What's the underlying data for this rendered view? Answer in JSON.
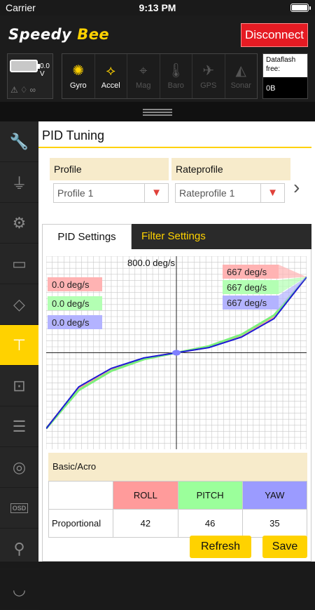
{
  "status_bar": {
    "carrier": "Carrier",
    "time": "9:13 PM"
  },
  "header": {
    "logo_main": "Speedy",
    "logo_accent": "Bee",
    "disconnect_label": "Disconnect",
    "battery_voltage": "0.0 V",
    "sensors": [
      {
        "name": "gyro",
        "label": "Gyro",
        "icon": "gyro-icon",
        "active": true
      },
      {
        "name": "accel",
        "label": "Accel",
        "icon": "accel-icon",
        "active": true
      },
      {
        "name": "mag",
        "label": "Mag",
        "icon": "mag-icon",
        "active": false
      },
      {
        "name": "baro",
        "label": "Baro",
        "icon": "baro-icon",
        "active": false
      },
      {
        "name": "gps",
        "label": "GPS",
        "icon": "gps-icon",
        "active": false
      },
      {
        "name": "sonar",
        "label": "Sonar",
        "icon": "sonar-icon",
        "active": false
      }
    ],
    "dataflash_label": "Dataflash free:",
    "dataflash_value": "0B"
  },
  "sidebar": {
    "items": [
      {
        "icon": "wrench-icon",
        "active": false
      },
      {
        "icon": "plug-icon",
        "active": false
      },
      {
        "icon": "gear-icon",
        "active": false
      },
      {
        "icon": "battery-icon",
        "active": false
      },
      {
        "icon": "parachute-icon",
        "active": false
      },
      {
        "icon": "hierarchy-icon",
        "active": true
      },
      {
        "icon": "receiver-icon",
        "active": false
      },
      {
        "icon": "modes-icon",
        "active": false
      },
      {
        "icon": "motor-icon",
        "active": false
      },
      {
        "icon": "osd-icon",
        "active": false,
        "text": "OSD"
      },
      {
        "icon": "led-icon",
        "active": false
      },
      {
        "icon": "blackbox-icon",
        "active": false
      }
    ]
  },
  "page": {
    "title": "PID Tuning",
    "profile_label": "Profile",
    "profile_value": "Profile 1",
    "rateprofile_label": "Rateprofile",
    "rateprofile_value": "Rateprofile 1",
    "tabs": {
      "pid": "PID Settings",
      "filter": "Filter Settings"
    },
    "basic_label": "Basic/Acro",
    "table": {
      "columns": [
        "ROLL",
        "PITCH",
        "YAW"
      ],
      "rows": [
        {
          "name": "Proportional",
          "values": [
            "42",
            "46",
            "35"
          ]
        }
      ]
    },
    "refresh_label": "Refresh",
    "save_label": "Save"
  },
  "chart_data": {
    "type": "line",
    "title": "800.0 deg/s",
    "xlim": [
      -1,
      1
    ],
    "ylim": [
      -800,
      800
    ],
    "grid": true,
    "current_rate_labels": [
      "0.0 deg/s",
      "0.0 deg/s",
      "0.0 deg/s"
    ],
    "max_rate_labels": [
      "667 deg/s",
      "667 deg/s",
      "667 deg/s"
    ],
    "series": [
      {
        "name": "ROLL",
        "color": "#ff9b9b",
        "x": [
          -1,
          -0.75,
          -0.5,
          -0.25,
          0,
          0.25,
          0.5,
          0.75,
          1
        ],
        "values": [
          -667,
          -310,
          -145,
          -50,
          0,
          50,
          145,
          310,
          667
        ]
      },
      {
        "name": "PITCH",
        "color": "#7cf07c",
        "x": [
          -1,
          -0.75,
          -0.5,
          -0.25,
          0,
          0.25,
          0.5,
          0.75,
          1
        ],
        "values": [
          -667,
          -330,
          -160,
          -58,
          0,
          58,
          160,
          330,
          667
        ]
      },
      {
        "name": "YAW",
        "color": "#1b1bd6",
        "x": [
          -1,
          -0.75,
          -0.5,
          -0.25,
          0,
          0.25,
          0.5,
          0.75,
          1
        ],
        "values": [
          -667,
          -300,
          -138,
          -46,
          0,
          46,
          138,
          300,
          667
        ]
      }
    ],
    "colors": {
      "accent": "#ffd200",
      "roll": "#ff9b9b",
      "pitch": "#9bff9b",
      "yaw": "#9b9bff",
      "disconnect": "#e51b23"
    }
  }
}
